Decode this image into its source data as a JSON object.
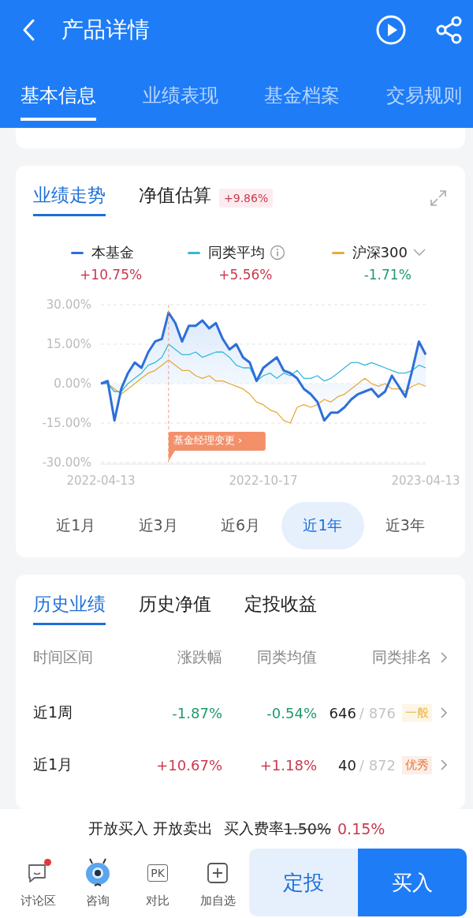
{
  "header": {
    "title": "产品详情"
  },
  "tabs": [
    {
      "label": "基本信息",
      "selected": true
    },
    {
      "label": "业绩表现",
      "selected": false
    },
    {
      "label": "基金档案",
      "selected": false
    },
    {
      "label": "交易规则",
      "selected": false
    }
  ],
  "performance": {
    "tabs": [
      {
        "label": "业绩走势",
        "selected": true
      },
      {
        "label": "净值估算",
        "selected": false
      }
    ],
    "estimate_badge": "+9.86%",
    "legend": [
      {
        "value": "+10.75%",
        "gain": true,
        "kind": "plain"
      },
      {
        "value": "+5.56%",
        "gain": true,
        "kind": "info"
      },
      {
        "value": "-1.71%",
        "gain": false,
        "kind": "dropdown"
      }
    ],
    "chart_data": {
      "type": "line",
      "grid": true,
      "categories": [
        "2022-04-13",
        null,
        null,
        null,
        null,
        null,
        null,
        null,
        null,
        null,
        null,
        null,
        null,
        null,
        null,
        null,
        null,
        null,
        null,
        null,
        null,
        null,
        null,
        null,
        "2022-10-17",
        null,
        null,
        null,
        null,
        null,
        null,
        null,
        null,
        null,
        null,
        null,
        null,
        null,
        null,
        null,
        null,
        null,
        null,
        null,
        null,
        null,
        null,
        null,
        "2023-04-13"
      ],
      "ylim": [
        -30,
        30
      ],
      "yticks": [
        {
          "value": 30,
          "label": "30.00%"
        },
        {
          "value": 15,
          "label": "15.00%"
        },
        {
          "value": 0,
          "label": "0.00%"
        },
        {
          "value": -15,
          "label": "-15.00%"
        },
        {
          "value": -30,
          "label": "-30.00%"
        }
      ],
      "series": [
        {
          "name": "本基金",
          "type": "area",
          "color": "#2e6fd8",
          "values": [
            0,
            1,
            -14,
            -2,
            4,
            8,
            6,
            12,
            16,
            17,
            27,
            23,
            16,
            22,
            22,
            24,
            21,
            23,
            17,
            13,
            15,
            10,
            8,
            1,
            6,
            8,
            10,
            5,
            4,
            2,
            -2,
            -4,
            -7,
            -14,
            -11,
            -11,
            -9,
            -6,
            -4,
            -3,
            -2,
            -5,
            -3,
            3,
            -1,
            -5,
            5,
            16,
            11
          ]
        },
        {
          "name": "同类平均",
          "type": "line",
          "color": "#35b8d8",
          "values": [
            0,
            0,
            -3,
            -3,
            0,
            2,
            4,
            7,
            8,
            10,
            15,
            13,
            11,
            11,
            12,
            10,
            11,
            12,
            12,
            10,
            7,
            6,
            6,
            1,
            3,
            4,
            2,
            4,
            3,
            5,
            2,
            2,
            3,
            1,
            2,
            4,
            6,
            8,
            8,
            7,
            8,
            7,
            6,
            5,
            4,
            4,
            5,
            7,
            6
          ]
        },
        {
          "name": "沪深300",
          "type": "line",
          "color": "#e8a93a",
          "values": [
            0,
            0,
            -2,
            -4,
            -2,
            0,
            2,
            4,
            5,
            7,
            9,
            7,
            5,
            5,
            3,
            2,
            3,
            1,
            1,
            0,
            -1,
            -2,
            -4,
            -7,
            -8,
            -10,
            -11,
            -14,
            -15,
            -9,
            -8,
            -9,
            -8,
            -6,
            -7,
            -5,
            -4,
            -2,
            0,
            2,
            0,
            -1,
            0,
            -2,
            -2,
            -3,
            -1,
            0,
            -1
          ]
        }
      ],
      "annotations": [
        "基金经理变更 ›"
      ]
    },
    "periods": [
      {
        "label": "近1月",
        "selected": false
      },
      {
        "label": "近3月",
        "selected": false
      },
      {
        "label": "近6月",
        "selected": false
      },
      {
        "label": "近1年",
        "selected": true
      },
      {
        "label": "近3年",
        "selected": false
      }
    ]
  },
  "history": {
    "tabs": [
      {
        "label": "历史业绩",
        "selected": true
      },
      {
        "label": "历史净值",
        "selected": false
      },
      {
        "label": "定投收益",
        "selected": false
      }
    ],
    "columns": [
      "时间区间",
      "涨跌幅",
      "同类均值",
      "同类排名"
    ],
    "rows": [
      {
        "period": "近1周",
        "change": "-1.87%",
        "change_gain": false,
        "average": "-0.54%",
        "average_gain": false,
        "rank": "646",
        "total": "/ 876",
        "rating": "一般",
        "color": "#e8b23a"
      },
      {
        "period": "近1月",
        "change": "+10.67%",
        "change_gain": true,
        "average": "+1.18%",
        "average_gain": true,
        "rank": "40",
        "total": "/ 872",
        "rating": "优秀",
        "color": "#e8763a"
      }
    ]
  },
  "footer": {
    "trade_status": "开放买入 开放卖出",
    "fee_label": "买入费率",
    "fee_original": "1.50%",
    "fee_current": "0.15%",
    "tools": [
      {
        "label": "讨论区",
        "kind": "comment",
        "badge": true
      },
      {
        "label": "咨询",
        "kind": "mascot",
        "badge": false
      },
      {
        "label": "对比",
        "kind": "compare",
        "icon_text": "PK",
        "badge": false
      },
      {
        "label": "加自选",
        "kind": "add",
        "badge": false
      }
    ],
    "buttons": [
      {
        "label": "定投",
        "kind": "secondary"
      },
      {
        "label": "买入",
        "kind": "primary"
      }
    ]
  }
}
